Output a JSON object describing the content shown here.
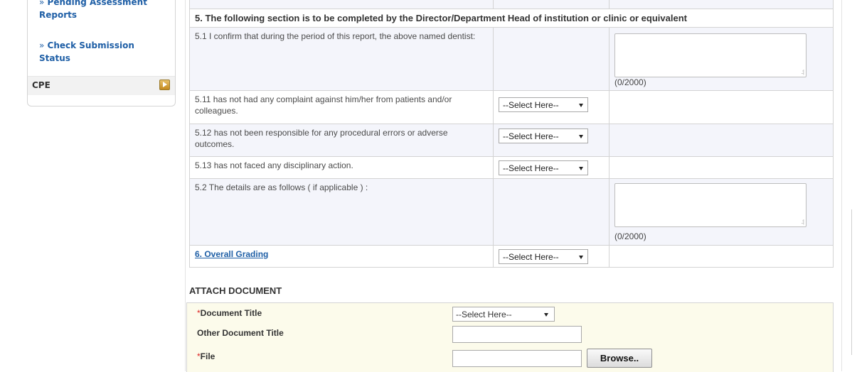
{
  "sidebar": {
    "links": [
      {
        "label": "Pending Assessment Reports",
        "line1": "Pending Assessment",
        "line2": "Reports"
      },
      {
        "label": "Check Submission Status",
        "line1": "Check Submission",
        "line2": "Status"
      }
    ],
    "bullet": "»",
    "cpe_label": "CPE"
  },
  "section5": {
    "header": "5. The following section is to be completed by the Director/Department Head of institution or clinic or equivalent",
    "rows": [
      {
        "id": "5.1",
        "text": "5.1 I confirm that during the period of this report, the above named dentist:",
        "counter": "(0/2000)"
      },
      {
        "id": "5.11",
        "text": "5.11 has not had any complaint against him/her from patients and/or colleagues.",
        "select": "--Select Here--"
      },
      {
        "id": "5.12",
        "text": "5.12 has not been responsible for any procedural errors or adverse outcomes.",
        "select": "--Select Here--"
      },
      {
        "id": "5.13",
        "text": "5.13 has not faced any disciplinary action.",
        "select": "--Select Here--"
      },
      {
        "id": "5.2",
        "text": "5.2 The details are as follows ( if applicable ) :",
        "counter": "(0/2000)"
      }
    ],
    "overall": {
      "label": "6. Overall Grading",
      "select": "--Select Here--"
    }
  },
  "attach": {
    "title": "ATTACH DOCUMENT",
    "required_mark": "*",
    "doc_title_label": "Document Title",
    "doc_title_select": "--Select Here--",
    "other_title_label": "Other Document Title",
    "file_label": "File",
    "browse_label": "Browse.."
  },
  "icons": {
    "cpe_expand": "expand-arrow-icon",
    "select_arrow": "chevron-down-icon"
  },
  "colors": {
    "link": "#1f5fa6",
    "required": "#dd2222",
    "attach_bg": "#fcfbeb",
    "alt_row_bg": "#f4f5fb"
  }
}
